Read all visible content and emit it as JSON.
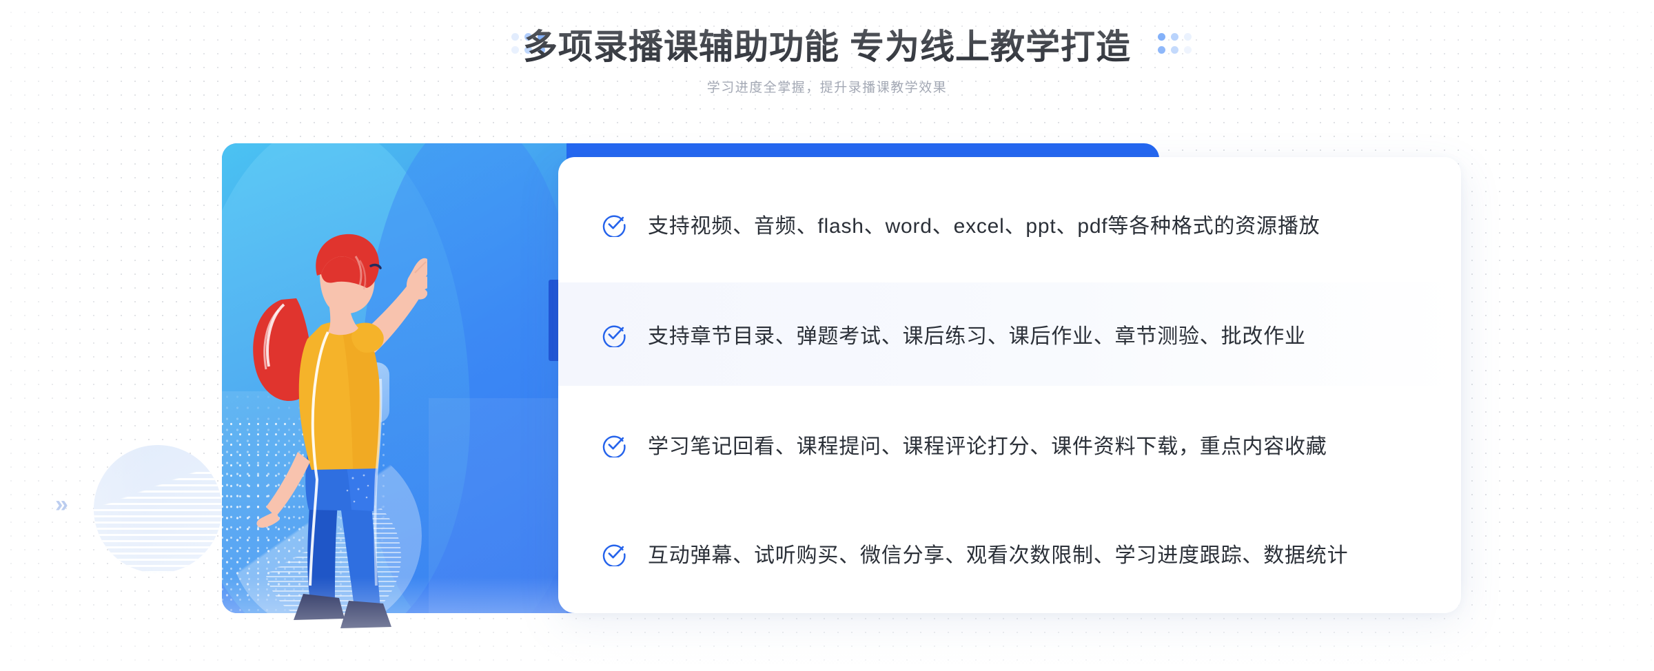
{
  "header": {
    "title": "多项录播课辅助功能 专为线上教学打造",
    "subtitle": "学习进度全掌握，提升录播课教学效果"
  },
  "colors": {
    "accent_blue": "#2467f0",
    "deep_blue": "#1f55d6",
    "check_blue": "#2563eb",
    "title_text": "#20242c",
    "subtitle_text": "#a3a8b4",
    "body_text": "#2b3038",
    "panel_gradient_start": "#4bc3f2",
    "panel_gradient_end": "#2f72f2",
    "shirt_yellow": "#f5b32a",
    "hair_red": "#e0342e",
    "jeans_blue": "#2f6fe0",
    "shoe_navy": "#232c5c",
    "skin": "#f8c3ae"
  },
  "illustration": {
    "alt": "woman pointing up at video play speech bubble",
    "play_icon": "play-icon",
    "bubble_icon": "speech-bubble-icon",
    "chevron_left_icon": "chevron-left-icon",
    "chevron_right_icon": "chevron-right-icon"
  },
  "features": [
    {
      "icon": "check-circle-icon",
      "text": "支持视频、音频、flash、word、excel、ppt、pdf等各种格式的资源播放"
    },
    {
      "icon": "check-circle-icon",
      "text": "支持章节目录、弹题考试、课后练习、课后作业、章节测验、批改作业"
    },
    {
      "icon": "check-circle-icon",
      "text": "学习笔记回看、课程提问、课程评论打分、课件资料下载，重点内容收藏"
    },
    {
      "icon": "check-circle-icon",
      "text": "互动弹幕、试听购买、微信分享、观看次数限制、学习进度跟踪、数据统计"
    }
  ]
}
